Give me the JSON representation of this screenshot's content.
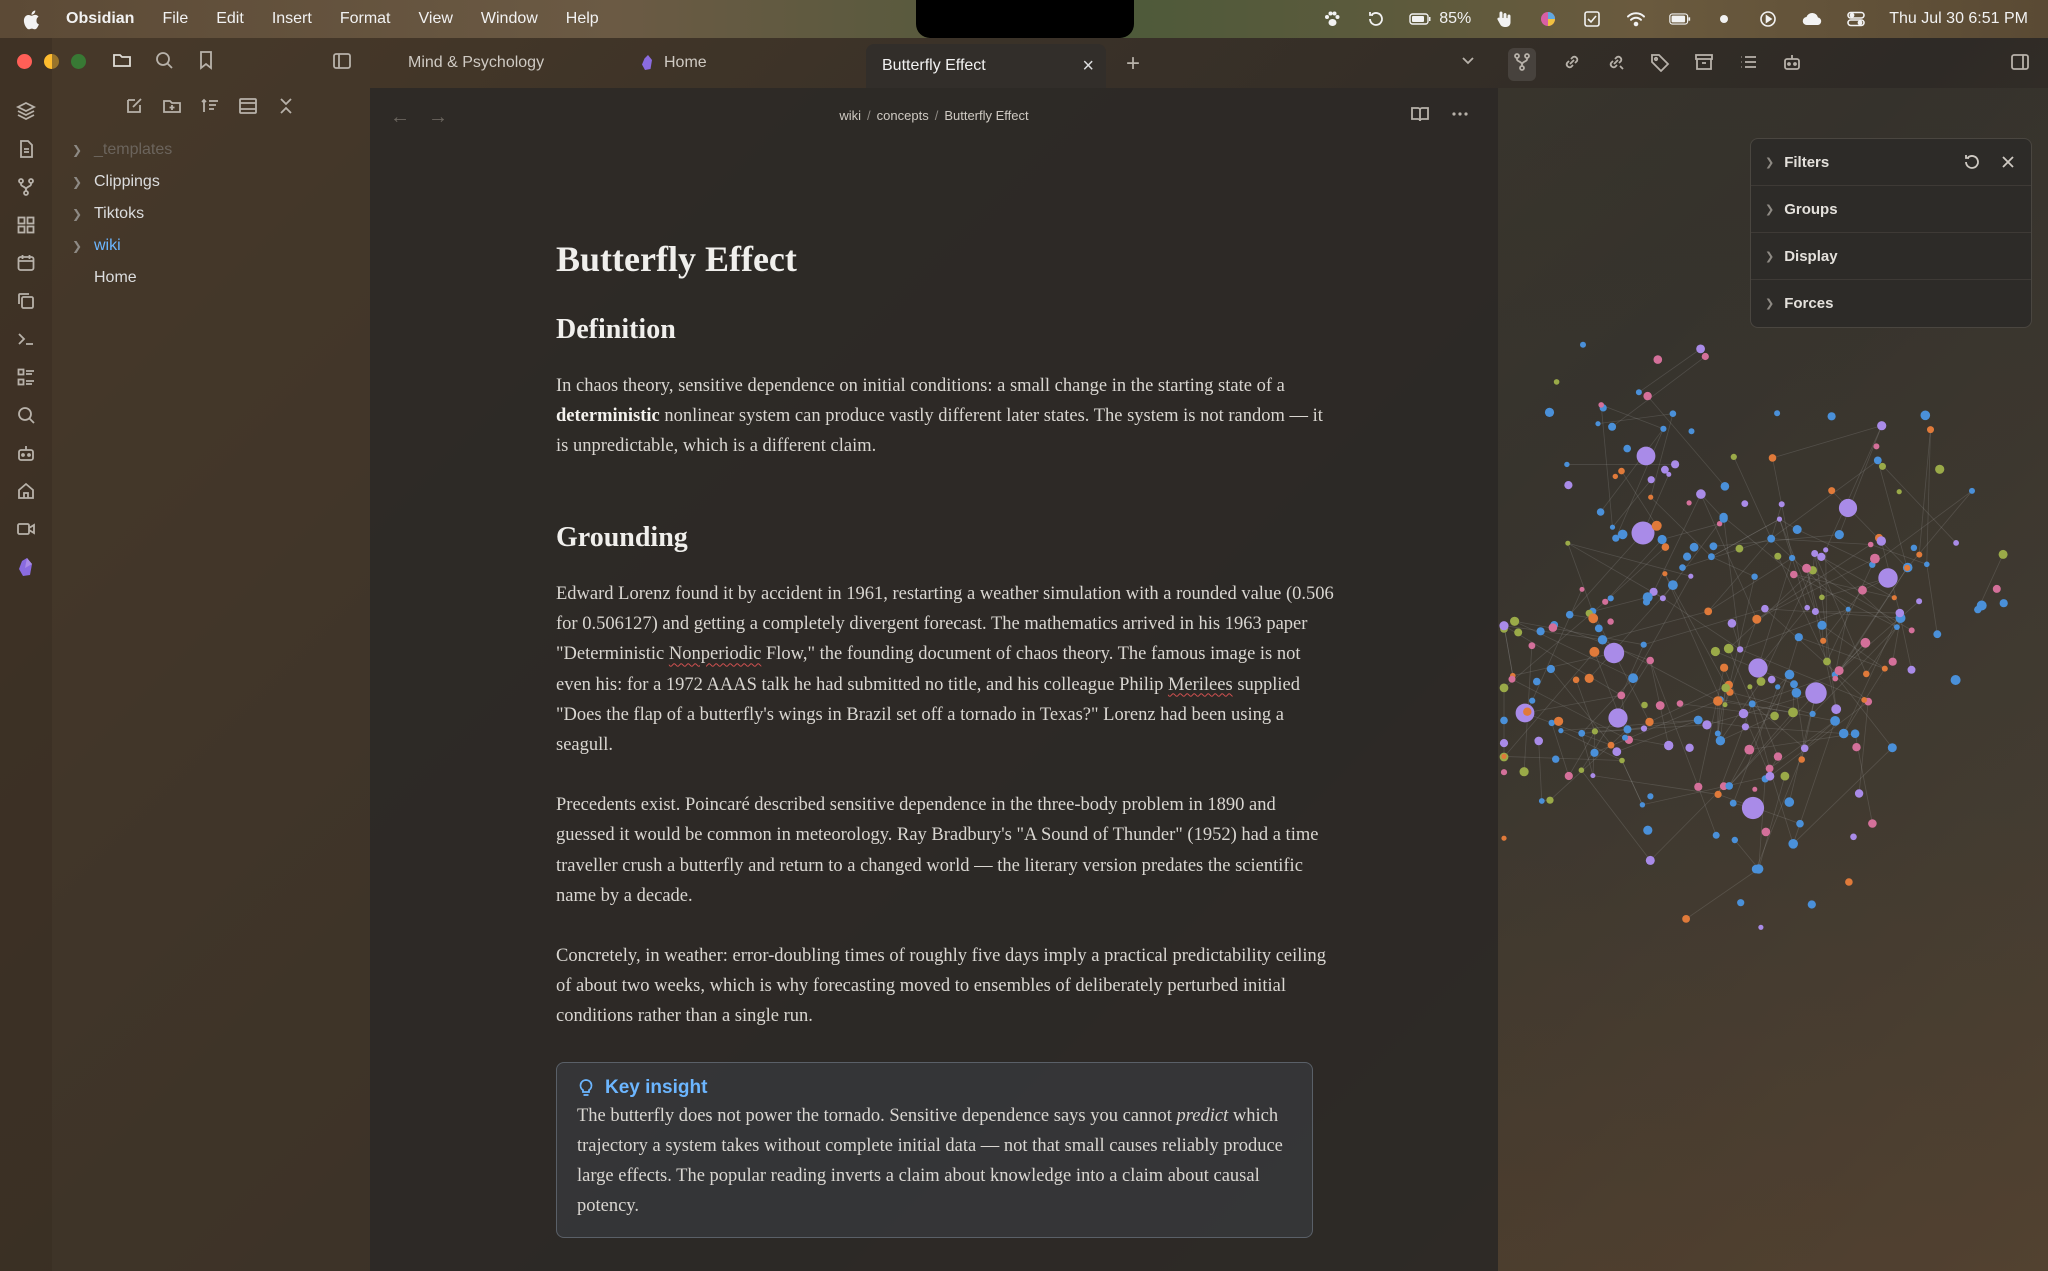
{
  "menubar": {
    "app_name": "Obsidian",
    "items": [
      "File",
      "Edit",
      "Insert",
      "Format",
      "View",
      "Window",
      "Help"
    ],
    "battery": "85%",
    "datetime": "Thu Jul 30  6:51 PM"
  },
  "explorer": {
    "tree": [
      {
        "label": "_templates",
        "type": "folder",
        "dim": true
      },
      {
        "label": "Clippings",
        "type": "folder"
      },
      {
        "label": "Tiktoks",
        "type": "folder"
      },
      {
        "label": "wiki",
        "type": "folder",
        "active": true
      },
      {
        "label": "Home",
        "type": "file"
      }
    ]
  },
  "tabs": [
    {
      "label": "Mind & Psychology"
    },
    {
      "label": "Home"
    },
    {
      "label": "Butterfly Effect",
      "active": true
    }
  ],
  "breadcrumb": [
    "wiki",
    "concepts",
    "Butterfly Effect"
  ],
  "doc": {
    "title": "Butterfly Effect",
    "h_definition": "Definition",
    "def_p1_a": "In chaos theory, sensitive dependence on initial conditions: a small change in the starting state of a ",
    "def_p1_bold": "deterministic",
    "def_p1_b": " nonlinear system can produce vastly different later states. The system is not random — it is unpredictable, which is a different claim.",
    "h_grounding": "Grounding",
    "g_p1_a": "Edward Lorenz found it by accident in 1961, restarting a weather simulation with a rounded value (0.506 for 0.506127) and getting a completely divergent forecast. The mathematics arrived in his 1963 paper \"Deterministic ",
    "g_p1_sq1": "Nonperiodic",
    "g_p1_b": " Flow,\" the founding document of chaos theory. The famous image is not even his: for a 1972 AAAS talk he had submitted no title, and his colleague Philip ",
    "g_p1_sq2": "Merilees",
    "g_p1_c": " supplied \"Does the flap of a butterfly's wings in Brazil set off a tornado in Texas?\" Lorenz had been using a seagull.",
    "g_p2": "Precedents exist. Poincaré described sensitive dependence in the three-body problem in 1890 and guessed it would be common in meteorology. Ray Bradbury's \"A Sound of Thunder\" (1952) had a time traveller crush a butterfly and return to a changed world — the literary version predates the scientific name by a decade.",
    "g_p3": "Concretely, in weather: error-doubling times of roughly five days imply a practical predictability ceiling of about two weeks, which is why forecasting moved to ensembles of deliberately perturbed initial conditions rather than a single run.",
    "callout_title": "Key insight",
    "callout_a": "The butterfly does not power the tornado. Sensitive dependence says you cannot ",
    "callout_em": "predict",
    "callout_b": " which trajectory a system takes without complete initial data — not that small causes reliably produce large effects. The popular reading inverts a claim about knowledge into a claim about causal potency."
  },
  "graph_controls": {
    "rows": [
      "Filters",
      "Groups",
      "Display",
      "Forces"
    ]
  },
  "colors": {
    "accent_blue": "#6cb6ff",
    "node_blue": "#4a90d9",
    "node_purple": "#a98be8",
    "node_pink": "#d4709a",
    "node_orange": "#e07a3a",
    "node_green": "#9aaa48"
  }
}
